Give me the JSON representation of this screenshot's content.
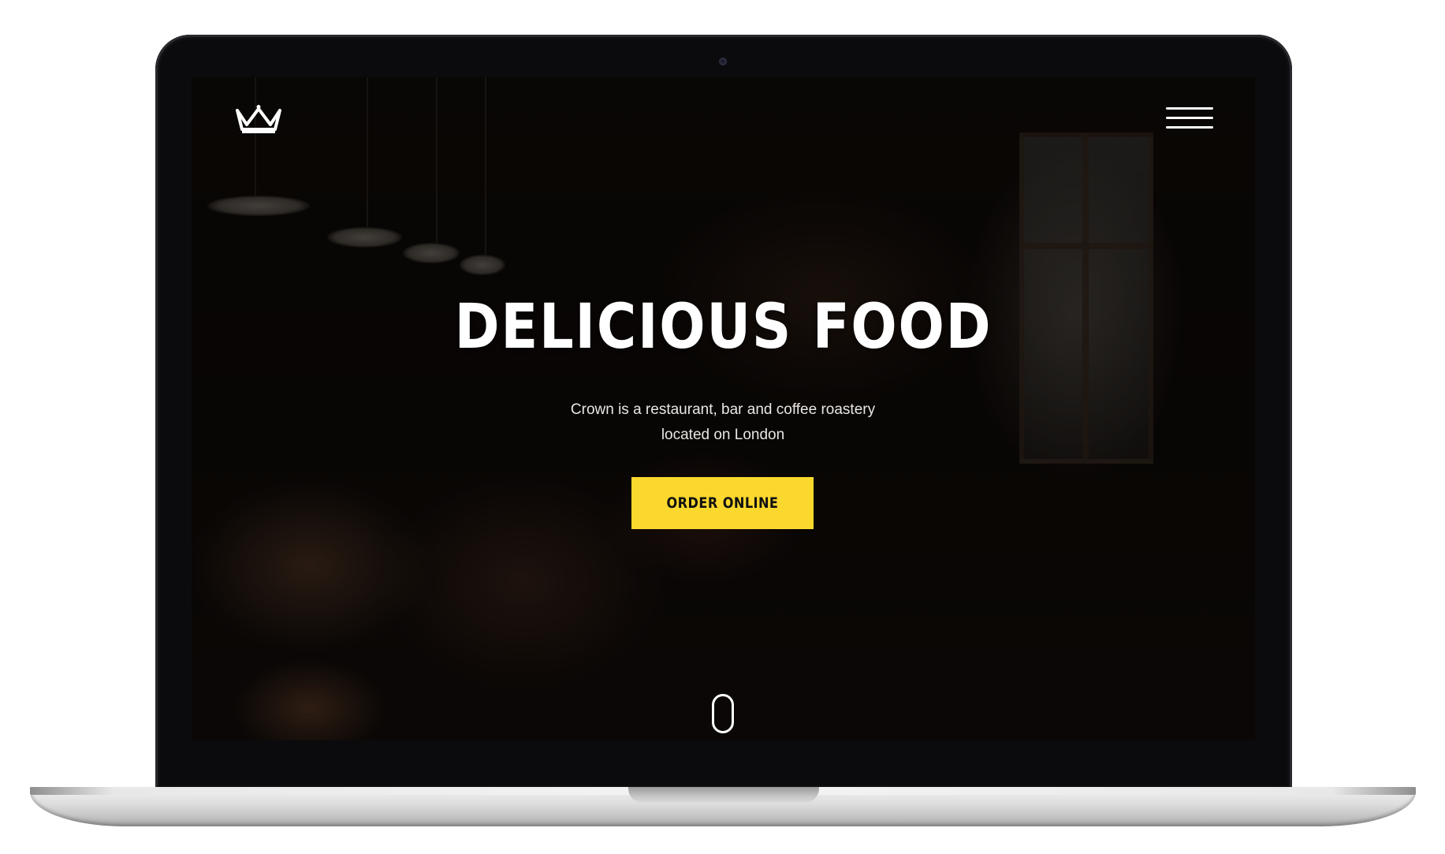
{
  "header": {
    "logo_icon": "crown-icon",
    "menu_icon": "hamburger-menu-icon"
  },
  "hero": {
    "title": "DELICIOUS FOOD",
    "subtitle": "Crown is a restaurant, bar and coffee roastery located on London",
    "cta_label": "ORDER ONLINE",
    "scroll_icon": "mouse-scroll-icon"
  },
  "colors": {
    "accent": "#fbd82d",
    "text": "#ffffff",
    "background": "#0b0807"
  }
}
